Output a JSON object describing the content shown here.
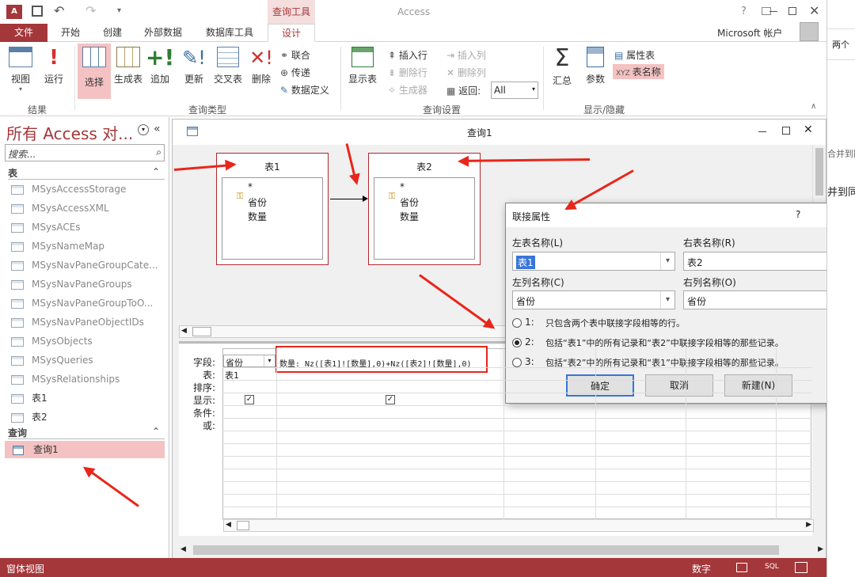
{
  "titlebar": {
    "app_name": "Access",
    "context_tab": "查询工具",
    "help": "?"
  },
  "tabs": [
    "文件",
    "开始",
    "创建",
    "外部数据",
    "数据库工具",
    "设计"
  ],
  "account": "Microsoft 帐户",
  "ribbon": {
    "groups": [
      "结果",
      "查询类型",
      "查询设置",
      "显示/隐藏"
    ],
    "results": [
      "视图",
      "运行"
    ],
    "query_type": [
      "选择",
      "生成表",
      "追加",
      "更新",
      "交叉表",
      "删除"
    ],
    "query_type_small": [
      "联合",
      "传递",
      "数据定义"
    ],
    "show_table": "显示表",
    "settings_small": [
      "插入行",
      "删除行",
      "生成器",
      "插入列",
      "删除列"
    ],
    "return_label": "返回:",
    "return_value": "All",
    "show_hide": [
      "汇总",
      "参数"
    ],
    "show_hide_small": [
      "属性表",
      "表名称"
    ]
  },
  "nav": {
    "title": "所有 Access 对...",
    "search_placeholder": "搜索...",
    "sections": [
      "表",
      "查询"
    ],
    "tables": [
      "MSysAccessStorage",
      "MSysAccessXML",
      "MSysACEs",
      "MSysNameMap",
      "MSysNavPaneGroupCate...",
      "MSysNavPaneGroups",
      "MSysNavPaneGroupToO...",
      "MSysNavPaneObjectIDs",
      "MSysObjects",
      "MSysQueries",
      "MSysRelationships",
      "表1",
      "表2"
    ],
    "queries": [
      "查询1"
    ]
  },
  "query_window": {
    "title": "查询1",
    "tables": [
      {
        "name": "表1",
        "fields": [
          "*",
          "省份",
          "数量"
        ]
      },
      {
        "name": "表2",
        "fields": [
          "*",
          "省份",
          "数量"
        ]
      }
    ],
    "row_labels": [
      "字段:",
      "表:",
      "排序:",
      "显示:",
      "条件:",
      "或:"
    ],
    "col1_field": "省份",
    "col1_table": "表1",
    "col2_field": "数量: Nz([表1]![数量],0)+Nz([表2]![数量],0)"
  },
  "dialog": {
    "title": "联接属性",
    "help": "?",
    "left_table_label": "左表名称(L)",
    "right_table_label": "右表名称(R)",
    "left_table": "表1",
    "right_table": "表2",
    "left_col_label": "左列名称(C)",
    "right_col_label": "右列名称(O)",
    "left_col": "省份",
    "right_col": "省份",
    "options": [
      {
        "num": "1:",
        "text": "只包含两个表中联接字段相等的行。"
      },
      {
        "num": "2:",
        "text": "包括“表1”中的所有记录和“表2”中联接字段相等的那些记录。"
      },
      {
        "num": "3:",
        "text": "包括“表2”中的所有记录和“表1”中联接字段相等的那些记录。"
      }
    ],
    "ok": "确定",
    "cancel": "取消",
    "new": "新建(N)"
  },
  "status": {
    "left": "窗体视图",
    "mode": "数字"
  },
  "right_edge": [
    "两个",
    "合并到同",
    "并到同"
  ],
  "colors": {
    "accent": "#a4373a",
    "arrow": "#e8261b",
    "highlight": "#f4c2c2"
  }
}
